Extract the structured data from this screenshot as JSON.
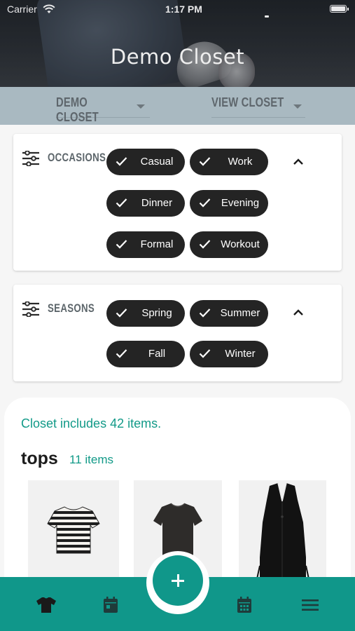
{
  "status_bar": {
    "carrier": "Carrier",
    "time": "1:17 PM"
  },
  "header": {
    "title": "Demo Closet"
  },
  "selectors": {
    "closet": {
      "label": "DEMO CLOSET"
    },
    "view": {
      "label": "VIEW CLOSET"
    }
  },
  "occasions": {
    "title": "OCCASIONS",
    "chips": [
      {
        "label": "Casual",
        "selected": true
      },
      {
        "label": "Work",
        "selected": true
      },
      {
        "label": "Dinner",
        "selected": true
      },
      {
        "label": "Evening",
        "selected": true
      },
      {
        "label": "Formal",
        "selected": true
      },
      {
        "label": "Workout",
        "selected": true
      }
    ]
  },
  "seasons": {
    "title": "SEASONS",
    "chips": [
      {
        "label": "Spring",
        "selected": true
      },
      {
        "label": "Summer",
        "selected": true
      },
      {
        "label": "Fall",
        "selected": true
      },
      {
        "label": "Winter",
        "selected": true
      }
    ]
  },
  "closet_panel": {
    "summary": "Closet includes 42 items.",
    "category": {
      "name": "tops",
      "count": "11 items"
    },
    "items": [
      {
        "icon": "striped-crop-tee"
      },
      {
        "icon": "black-tee"
      },
      {
        "icon": "black-vest"
      }
    ]
  },
  "bottom_nav": {
    "items": [
      {
        "icon": "shirt-icon"
      },
      {
        "icon": "calendar-icon"
      },
      {
        "icon": "add-icon"
      },
      {
        "icon": "calendar-grid-icon"
      },
      {
        "icon": "menu-icon"
      }
    ]
  },
  "colors": {
    "accent": "#10978a",
    "chip": "#242424",
    "selector_bar": "#a9b9c1",
    "header": "#2c3036"
  }
}
